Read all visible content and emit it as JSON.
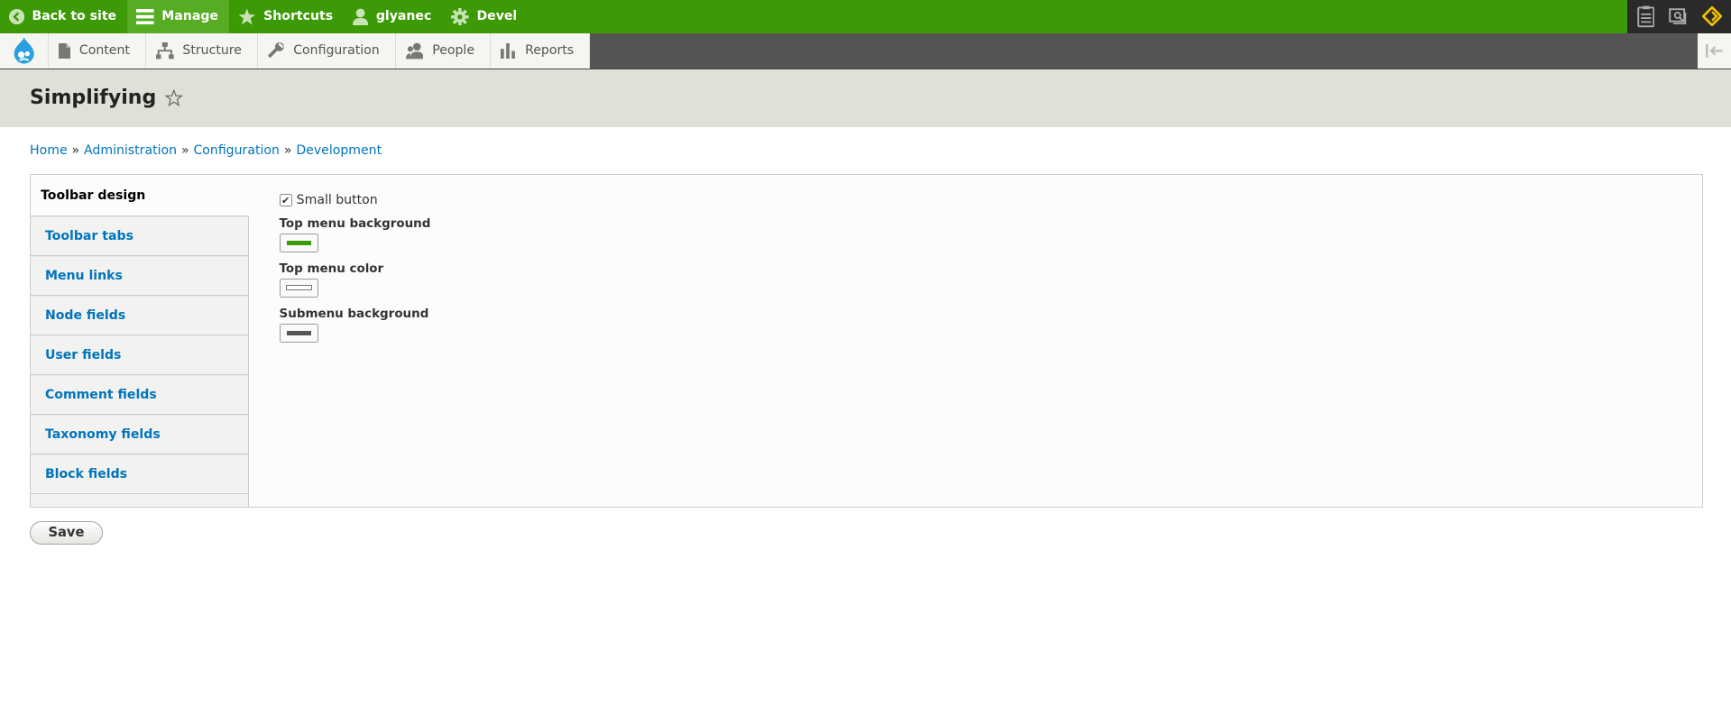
{
  "toolbar": {
    "back": "Back to site",
    "manage": "Manage",
    "shortcuts": "Shortcuts",
    "user": "glyanec",
    "devel": "Devel"
  },
  "tray": {
    "content": "Content",
    "structure": "Structure",
    "configuration": "Configuration",
    "people": "People",
    "reports": "Reports"
  },
  "page": {
    "title": "Simplifying"
  },
  "breadcrumb": {
    "home": "Home",
    "administration": "Administration",
    "configuration": "Configuration",
    "development": "Development",
    "separator": "»"
  },
  "tabs": {
    "items": [
      "Toolbar design",
      "Toolbar tabs",
      "Menu links",
      "Node fields",
      "User fields",
      "Comment fields",
      "Taxonomy fields",
      "Block fields"
    ]
  },
  "form": {
    "small_button_label": "Small button",
    "small_button_checked": true,
    "top_menu_bg_label": "Top menu background",
    "top_menu_bg_color": "#3c9a06",
    "top_menu_color_label": "Top menu color",
    "top_menu_color_value": "#ffffff",
    "submenu_bg_label": "Submenu background",
    "submenu_bg_color": "#555555",
    "save_label": "Save"
  }
}
